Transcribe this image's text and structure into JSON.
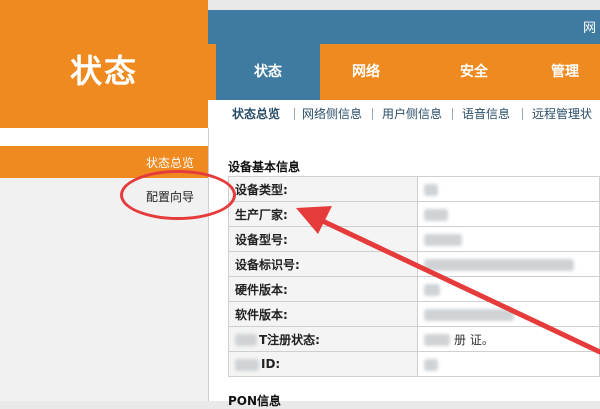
{
  "header": {
    "brand_title": "状态",
    "strip_text": "网",
    "tabs": [
      {
        "label": "状态"
      },
      {
        "label": "网络"
      },
      {
        "label": "安全"
      },
      {
        "label": "管理"
      }
    ],
    "subnav": [
      {
        "label": "状态总览"
      },
      {
        "label": "网络侧信息"
      },
      {
        "label": "用户侧信息"
      },
      {
        "label": "语音信息"
      },
      {
        "label": "远程管理状"
      }
    ]
  },
  "sidebar": {
    "items": [
      {
        "label": "状态总览"
      },
      {
        "label": "配置向导"
      }
    ]
  },
  "main": {
    "section_title": "设备基本信息",
    "rows": [
      {
        "key": "设备类型:",
        "value": ""
      },
      {
        "key": "生产厂家:",
        "value": ""
      },
      {
        "key": "设备型号:",
        "value": ""
      },
      {
        "key": "设备标识号:",
        "value": ""
      },
      {
        "key": "硬件版本:",
        "value": ""
      },
      {
        "key": "软件版本:",
        "value": ""
      },
      {
        "key": "T注册状态:",
        "value": "册 证。"
      },
      {
        "key": "ID:",
        "value": ""
      }
    ],
    "pon_title": "PON信息"
  },
  "colors": {
    "orange": "#ee8a1f",
    "blue": "#3f7aa0",
    "annotation_red": "#e53b3b"
  }
}
